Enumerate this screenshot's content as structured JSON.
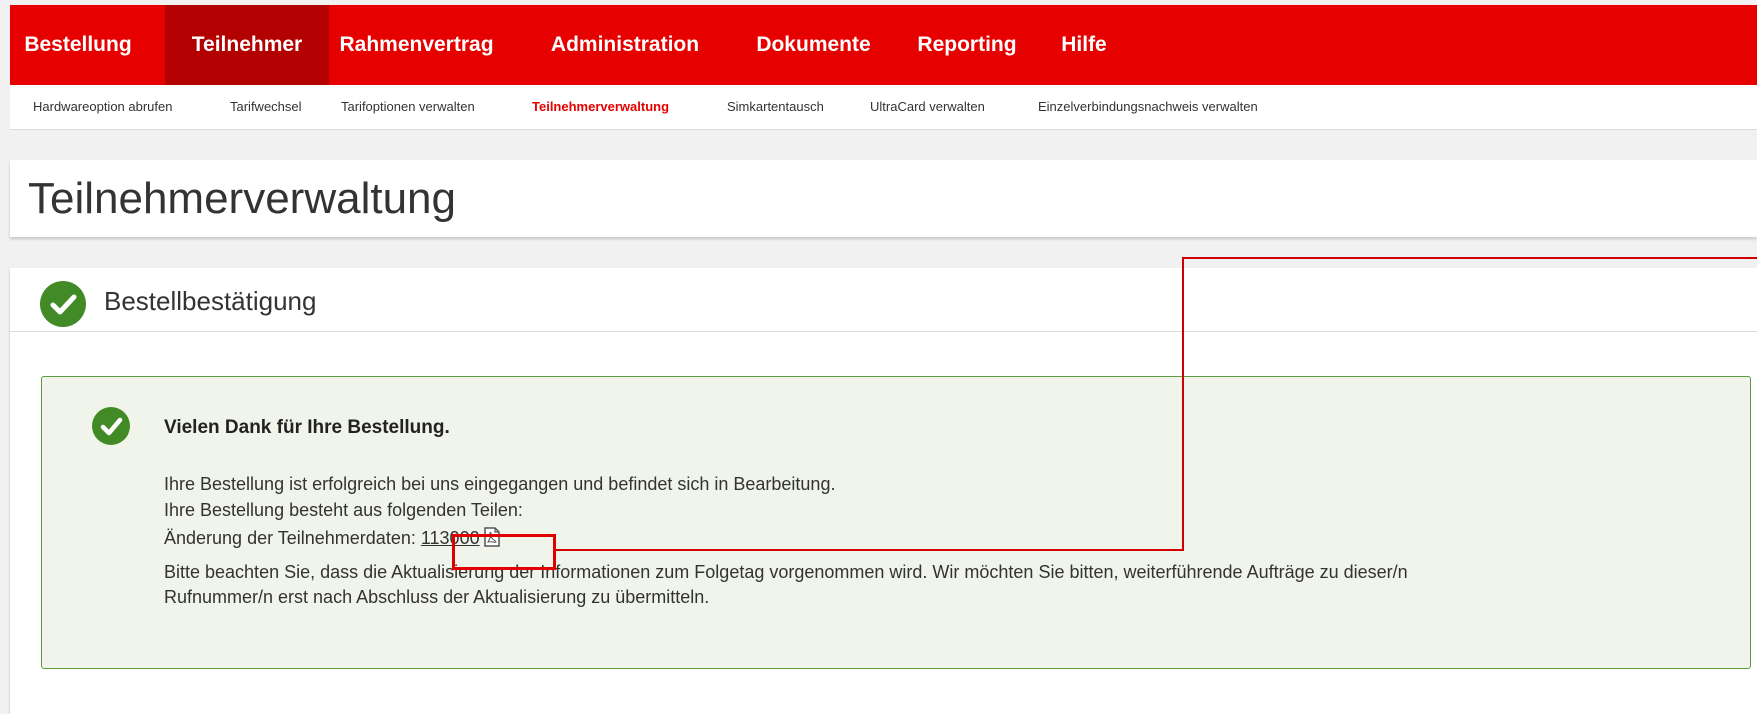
{
  "top_nav": {
    "tabs": [
      {
        "label": "Bestellung"
      },
      {
        "label": "Teilnehmer"
      },
      {
        "label": "Rahmenvertrag"
      },
      {
        "label": "Administration"
      },
      {
        "label": "Dokumente"
      },
      {
        "label": "Reporting"
      },
      {
        "label": "Hilfe"
      }
    ],
    "active": "Teilnehmer"
  },
  "sub_nav": {
    "items": [
      {
        "label": "Hardwareoption abrufen"
      },
      {
        "label": "Tarifwechsel"
      },
      {
        "label": "Tarifoptionen verwalten"
      },
      {
        "label": "Teilnehmerverwaltung"
      },
      {
        "label": "Simkartentausch"
      },
      {
        "label": "UltraCard verwalten"
      },
      {
        "label": "Einzelverbindungsnachweis verwalten"
      }
    ],
    "active": "Teilnehmerverwaltung"
  },
  "page": {
    "title": "Teilnehmerverwaltung"
  },
  "section": {
    "title": "Bestellbestätigung",
    "icon": "check-circle-icon"
  },
  "alert": {
    "icon": "check-circle-icon",
    "title": "Vielen Dank für Ihre Bestellung.",
    "line1": "Ihre Bestellung ist erfolgreich bei uns eingegangen und befindet sich in Bearbeitung.",
    "line2": "Ihre Bestellung besteht aus folgenden Teilen:",
    "doc_label": "Änderung der Teilnehmerdaten:",
    "doc_number": "113000",
    "doc_icon": "pdf-icon",
    "note_line1": "Bitte beachten Sie, dass die Aktualisierung der Informationen zum Folgetag vorgenommen wird. Wir möchten Sie bitten, weiterführende Aufträge zu dieser/n",
    "note_line2": "Rufnummer/n erst nach Abschluss der Aktualisierung zu übermitteln."
  },
  "colors": {
    "brand_red": "#e60000",
    "success_green": "#428a25",
    "highlight_red": "#e00000"
  }
}
